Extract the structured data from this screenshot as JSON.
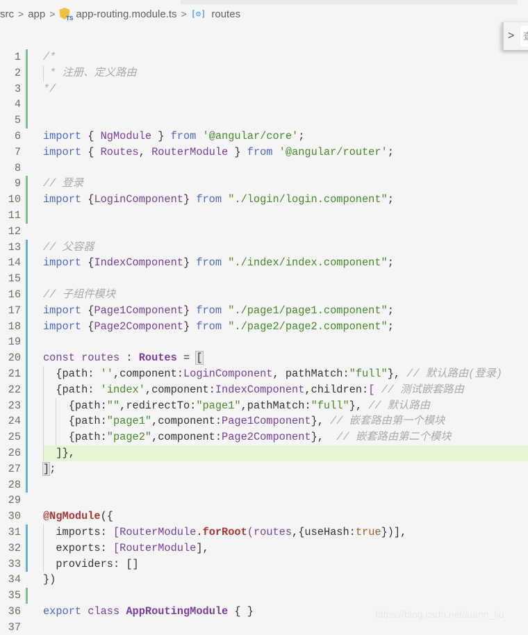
{
  "breadcrumb": {
    "items": [
      "src",
      "app",
      "app-routing.module.ts",
      "routes"
    ],
    "file_icon": "angular-ts-file-icon",
    "symbol_icon": "variable-symbol-icon"
  },
  "find_widget": {
    "toggle": ">",
    "input_placeholder": "查"
  },
  "colors": {
    "keyword": "#4b69c6",
    "storage": "#7a3e9d",
    "string": "#448c27",
    "comment": "#aaaaaa",
    "decorator": "#aa3731",
    "added_bar": "#7fbf8a",
    "modified_bar": "#66afe0",
    "current_line": "#e4f6d4"
  },
  "editor": {
    "highlighted_line": 26,
    "lines": [
      {
        "n": 1,
        "change": "added",
        "tokens": [
          [
            "c",
            "/*"
          ]
        ]
      },
      {
        "n": 2,
        "change": "added",
        "guides": [
          0
        ],
        "tokens": [
          [
            "c",
            " * 注册、定义路由"
          ]
        ]
      },
      {
        "n": 3,
        "change": "added",
        "tokens": [
          [
            "c",
            "*/"
          ]
        ]
      },
      {
        "n": 4,
        "change": "added",
        "tokens": []
      },
      {
        "n": 5,
        "change": "added",
        "tokens": []
      },
      {
        "n": 6,
        "tokens": [
          [
            "k",
            "import"
          ],
          [
            "t",
            " { "
          ],
          [
            "v",
            "NgModule"
          ],
          [
            "t",
            " } "
          ],
          [
            "k",
            "from"
          ],
          [
            "t",
            " "
          ],
          [
            "str",
            "'@angular/core'"
          ],
          [
            "t",
            ";"
          ]
        ]
      },
      {
        "n": 7,
        "tokens": [
          [
            "k",
            "import"
          ],
          [
            "t",
            " { "
          ],
          [
            "v",
            "Routes"
          ],
          [
            "t",
            ", "
          ],
          [
            "v",
            "RouterModule"
          ],
          [
            "t",
            " } "
          ],
          [
            "k",
            "from"
          ],
          [
            "t",
            " "
          ],
          [
            "str",
            "'@angular/router'"
          ],
          [
            "t",
            ";"
          ]
        ]
      },
      {
        "n": 8,
        "tokens": []
      },
      {
        "n": 9,
        "change": "added",
        "tokens": [
          [
            "c",
            "// 登录"
          ]
        ]
      },
      {
        "n": 10,
        "change": "added",
        "tokens": [
          [
            "k",
            "import"
          ],
          [
            "t",
            " {"
          ],
          [
            "v",
            "LoginComponent"
          ],
          [
            "t",
            "} "
          ],
          [
            "k",
            "from"
          ],
          [
            "t",
            " "
          ],
          [
            "str",
            "\"./login/login.component\""
          ],
          [
            "t",
            ";"
          ]
        ]
      },
      {
        "n": 11,
        "change": "added",
        "tokens": []
      },
      {
        "n": 12,
        "tokens": []
      },
      {
        "n": 13,
        "change": "modified",
        "tokens": [
          [
            "c",
            "// 父容器"
          ]
        ]
      },
      {
        "n": 14,
        "change": "modified",
        "tokens": [
          [
            "k",
            "import"
          ],
          [
            "t",
            " {"
          ],
          [
            "v",
            "IndexComponent"
          ],
          [
            "t",
            "} "
          ],
          [
            "k",
            "from"
          ],
          [
            "t",
            " "
          ],
          [
            "str",
            "\"./index/index.component\""
          ],
          [
            "t",
            ";"
          ]
        ]
      },
      {
        "n": 15,
        "change": "modified",
        "tokens": []
      },
      {
        "n": 16,
        "change": "modified",
        "tokens": [
          [
            "c",
            "// 子组件模块"
          ]
        ]
      },
      {
        "n": 17,
        "change": "modified",
        "tokens": [
          [
            "k",
            "import"
          ],
          [
            "t",
            " {"
          ],
          [
            "v",
            "Page1Component"
          ],
          [
            "t",
            "} "
          ],
          [
            "k",
            "from"
          ],
          [
            "t",
            " "
          ],
          [
            "str",
            "\"./page1/page1.component\""
          ],
          [
            "t",
            ";"
          ]
        ]
      },
      {
        "n": 18,
        "change": "modified",
        "tokens": [
          [
            "k",
            "import"
          ],
          [
            "t",
            " {"
          ],
          [
            "v",
            "Page2Component"
          ],
          [
            "t",
            "} "
          ],
          [
            "k",
            "from"
          ],
          [
            "t",
            " "
          ],
          [
            "str",
            "\"./page2/page2.component\""
          ],
          [
            "t",
            ";"
          ]
        ]
      },
      {
        "n": 19,
        "change": "modified",
        "tokens": []
      },
      {
        "n": 20,
        "change": "modified",
        "tokens": [
          [
            "s",
            "const"
          ],
          [
            "t",
            " "
          ],
          [
            "v",
            "routes"
          ],
          [
            "t",
            " : "
          ],
          [
            "cls",
            "Routes"
          ],
          [
            "t",
            " = "
          ],
          [
            "b",
            "["
          ]
        ]
      },
      {
        "n": 21,
        "change": "modified",
        "guides": [
          0
        ],
        "tokens": [
          [
            "t",
            "  {path: "
          ],
          [
            "str",
            "''"
          ],
          [
            "t",
            ",component:"
          ],
          [
            "v",
            "LoginComponent"
          ],
          [
            "t",
            ", pathMatch:"
          ],
          [
            "str",
            "\"full\""
          ],
          [
            "t",
            "}, "
          ],
          [
            "c",
            "// 默认路由(登录)"
          ]
        ]
      },
      {
        "n": 22,
        "change": "modified",
        "guides": [
          0
        ],
        "tokens": [
          [
            "t",
            "  {path: "
          ],
          [
            "str",
            "'index'"
          ],
          [
            "t",
            ",component:"
          ],
          [
            "v",
            "IndexComponent"
          ],
          [
            "t",
            ",children:"
          ],
          [
            "v",
            "["
          ],
          [
            "t",
            " "
          ],
          [
            "c",
            "// 测试嵌套路由"
          ]
        ]
      },
      {
        "n": 23,
        "change": "modified",
        "guides": [
          0,
          1
        ],
        "tokens": [
          [
            "t",
            "    {path:"
          ],
          [
            "str",
            "\"\""
          ],
          [
            "t",
            ",redirectTo:"
          ],
          [
            "str",
            "\"page1\""
          ],
          [
            "t",
            ",pathMatch:"
          ],
          [
            "str",
            "\"full\""
          ],
          [
            "t",
            "}, "
          ],
          [
            "c",
            "// 默认路由"
          ]
        ]
      },
      {
        "n": 24,
        "change": "modified",
        "guides": [
          0,
          1
        ],
        "tokens": [
          [
            "t",
            "    {path:"
          ],
          [
            "str",
            "\"page1\""
          ],
          [
            "t",
            ",component:"
          ],
          [
            "v",
            "Page1Component"
          ],
          [
            "t",
            "}, "
          ],
          [
            "c",
            "// 嵌套路由第一个模块"
          ]
        ]
      },
      {
        "n": 25,
        "change": "modified",
        "guides": [
          0,
          1
        ],
        "tokens": [
          [
            "t",
            "    {path:"
          ],
          [
            "str",
            "\"page2\""
          ],
          [
            "t",
            ",component:"
          ],
          [
            "v",
            "Page2Component"
          ],
          [
            "t",
            "},  "
          ],
          [
            "c",
            "// 嵌套路由第二个模块"
          ]
        ]
      },
      {
        "n": 26,
        "change": "modified",
        "guides": [
          0
        ],
        "tokens": [
          [
            "t",
            "  ]},"
          ]
        ]
      },
      {
        "n": 27,
        "change": "modified",
        "tokens": [
          [
            "b",
            "]"
          ],
          [
            "t",
            ";"
          ]
        ]
      },
      {
        "n": 28,
        "change": "modified",
        "tokens": []
      },
      {
        "n": 29,
        "tokens": []
      },
      {
        "n": 30,
        "tokens": [
          [
            "dec",
            "@NgModule"
          ],
          [
            "t",
            "({"
          ]
        ]
      },
      {
        "n": 31,
        "change": "modified",
        "guides": [
          0
        ],
        "tokens": [
          [
            "t",
            "  imports: "
          ],
          [
            "v",
            "[RouterModule"
          ],
          [
            "t",
            "."
          ],
          [
            "fn",
            "forRoot"
          ],
          [
            "v",
            "(routes"
          ],
          [
            "t",
            ",{useHash:"
          ],
          [
            "const",
            "true"
          ],
          [
            "t",
            "})],"
          ]
        ]
      },
      {
        "n": 32,
        "change": "modified",
        "guides": [
          0
        ],
        "tokens": [
          [
            "t",
            "  exports: "
          ],
          [
            "v",
            "[RouterModule"
          ],
          [
            "t",
            "],"
          ]
        ]
      },
      {
        "n": 33,
        "change": "modified",
        "guides": [
          0
        ],
        "tokens": [
          [
            "t",
            "  providers: []"
          ]
        ]
      },
      {
        "n": 34,
        "tokens": [
          [
            "t",
            "})"
          ]
        ]
      },
      {
        "n": 35,
        "change": "added",
        "tokens": []
      },
      {
        "n": 36,
        "tokens": [
          [
            "k",
            "export"
          ],
          [
            "t",
            " "
          ],
          [
            "s",
            "class"
          ],
          [
            "t",
            " "
          ],
          [
            "cls",
            "AppRoutingModule"
          ],
          [
            "t",
            " { }"
          ]
        ]
      },
      {
        "n": 37,
        "tokens": []
      }
    ]
  },
  "watermark": "https://blog.csdn.net/luann_liu"
}
